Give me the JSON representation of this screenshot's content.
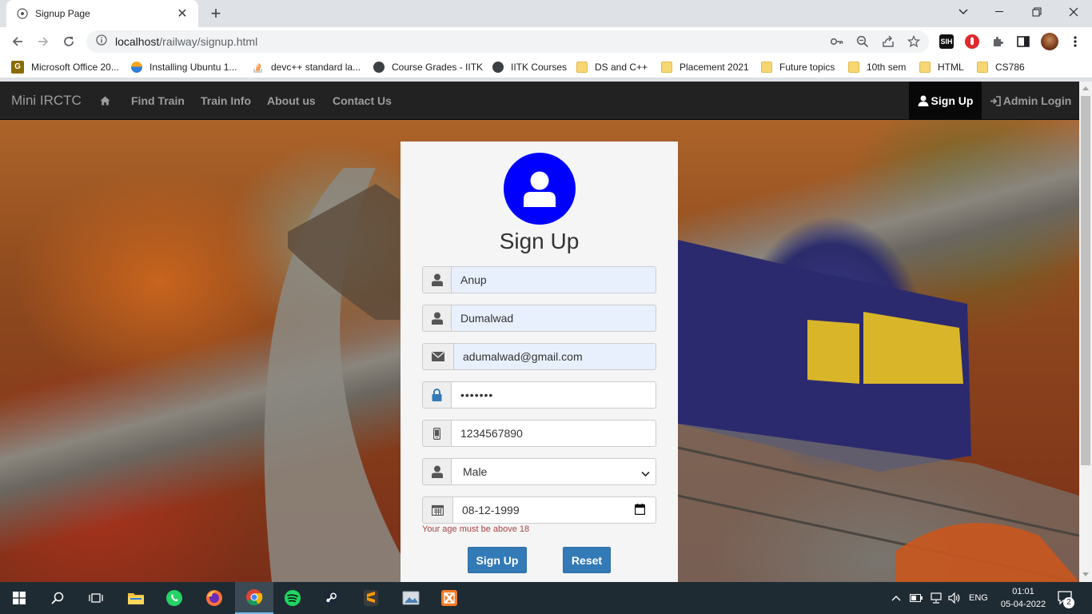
{
  "browser": {
    "tab_title": "Signup Page",
    "tab_close": "✕",
    "new_tab": "+",
    "url_host": "localhost",
    "url_path": "/railway/signup.html",
    "window_controls": {
      "minimize": "⌄",
      "restore": "—",
      "maximize": "❐",
      "close": "✕"
    },
    "extensions": {
      "sih_label": "SIH"
    }
  },
  "bookmarks": [
    {
      "label": "Microsoft Office 20...",
      "icon": "grammarly-icon"
    },
    {
      "label": "Installing Ubuntu 1...",
      "icon": "ubuntu-icon"
    },
    {
      "label": "devc++ standard la...",
      "icon": "stackoverflow-icon"
    },
    {
      "label": "Course Grades - IITK",
      "icon": "globe-icon"
    },
    {
      "label": "IITK Courses",
      "icon": "globe-icon"
    },
    {
      "label": "DS and C++",
      "icon": "folder-icon"
    },
    {
      "label": "Placement 2021",
      "icon": "folder-icon"
    },
    {
      "label": "Future topics",
      "icon": "folder-icon"
    },
    {
      "label": "10th sem",
      "icon": "folder-icon"
    },
    {
      "label": "HTML",
      "icon": "folder-icon"
    },
    {
      "label": "CS786",
      "icon": "folder-icon"
    }
  ],
  "navbar": {
    "brand": "Mini IRCTC",
    "links": [
      "Find Train",
      "Train Info",
      "About us",
      "Contact Us"
    ],
    "signup": "Sign Up",
    "admin_login": "Admin Login"
  },
  "form": {
    "title": "Sign Up",
    "first_name": "Anup",
    "last_name": "Dumalwad",
    "email": "adumalwad@gmail.com",
    "password": "•••••••",
    "phone": "1234567890",
    "gender": "Male",
    "gender_options": [
      "Male"
    ],
    "dob": "08-12-1999",
    "error": "Your age must be above 18",
    "submit": "Sign Up",
    "reset": "Reset"
  },
  "taskbar": {
    "lang": "ENG",
    "time": "01:01",
    "date": "05-04-2022",
    "notifications": "2"
  },
  "colors": {
    "navbar_bg": "#222222",
    "avatar": "#0000ff",
    "button": "#337ab7",
    "error": "#a94442",
    "autofill": "#e8f0fe"
  }
}
